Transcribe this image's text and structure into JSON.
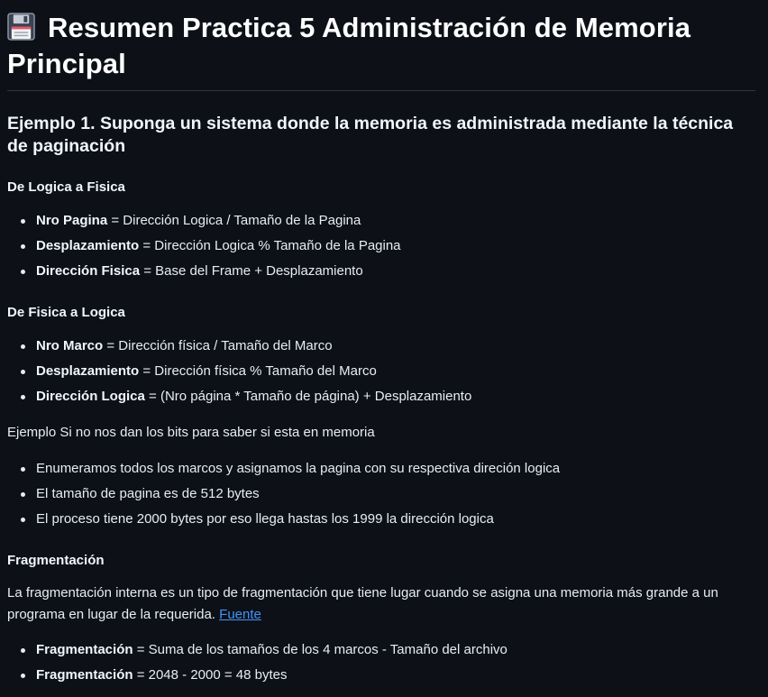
{
  "title": "Resumen Practica 5 Administración de Memoria Principal",
  "title_icon": "floppy-disk-icon",
  "example1_heading": "Ejemplo 1. Suponga un sistema donde la memoria es administrada mediante la técnica de paginación",
  "logica_a_fisica": {
    "heading": "De Logica a Fisica",
    "items": [
      {
        "term": "Nro Pagina",
        "rest": " = Dirección Logica / Tamaño de la Pagina"
      },
      {
        "term": "Desplazamiento",
        "rest": " = Dirección Logica % Tamaño de la Pagina"
      },
      {
        "term": "Dirección Fisica",
        "rest": " = Base del Frame + Desplazamiento"
      }
    ]
  },
  "fisica_a_logica": {
    "heading": "De Fisica a Logica",
    "items": [
      {
        "term": "Nro Marco",
        "rest": " = Dirección física / Tamaño del Marco"
      },
      {
        "term": "Desplazamiento",
        "rest": " = Dirección física % Tamaño del Marco"
      },
      {
        "term": "Dirección Logica",
        "rest": " = (Nro página * Tamaño de página) + Desplazamiento"
      }
    ]
  },
  "bits_example": {
    "intro": "Ejemplo Si no nos dan los bits para saber si esta en memoria",
    "items": [
      "Enumeramos todos los marcos y asignamos la pagina con su respectiva direción logica",
      "El tamaño de pagina es de 512 bytes",
      "El proceso tiene 2000 bytes por eso llega hastas los 1999 la dirección logica"
    ]
  },
  "fragmentacion": {
    "heading": "Fragmentación",
    "paragraph": "La fragmentación interna es un tipo de fragmentación que tiene lugar cuando se asigna una memoria más grande a un programa en lugar de la requerida. ",
    "link_text": "Fuente",
    "items": [
      {
        "term": "Fragmentación",
        "rest": " = Suma de los tamaños de los 4 marcos - Tamaño del archivo"
      },
      {
        "term": "Fragmentación",
        "rest": " = 2048 - 2000 = 48 bytes"
      }
    ]
  }
}
